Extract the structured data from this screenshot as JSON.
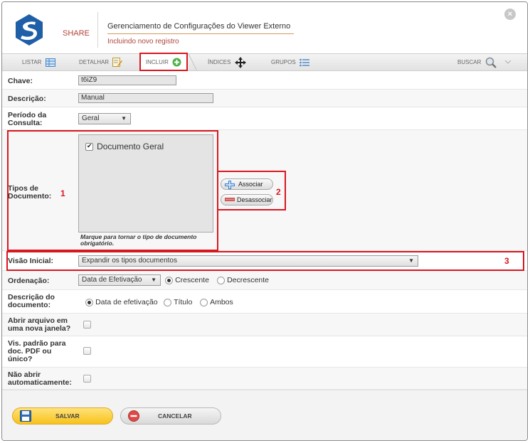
{
  "header": {
    "brand": "SHARE",
    "title": "Gerenciamento de Configurações do Viewer Externo",
    "subtitle": "Incluindo novo registro"
  },
  "tabs": {
    "listar": "LISTAR",
    "detalhar": "DETALHAR",
    "incluir": "INCLUIR",
    "indices": "ÍNDICES",
    "grupos": "GRUPOS",
    "buscar": "BUSCAR"
  },
  "form": {
    "chave": {
      "label": "Chave:",
      "value": "t6iZ9"
    },
    "descricao": {
      "label": "Descrição:",
      "value": "Manual"
    },
    "periodo": {
      "label": "Período da Consulta:",
      "value": "Geral"
    },
    "tipos": {
      "label": "Tipos de Documento:",
      "items": [
        {
          "label": "Documento Geral",
          "checked": true
        }
      ],
      "hint": "Marque para tornar o tipo de documento obrigatório.",
      "associar": "Associar",
      "desassociar": "Desassociar"
    },
    "visao": {
      "label": "Visão Inicial:",
      "value": "Expandir os tipos documentos"
    },
    "ordenacao": {
      "label": "Ordenação:",
      "value": "Data de Efetivação",
      "options": [
        "Crescente",
        "Decrescente"
      ],
      "selected": "Crescente"
    },
    "descricao_doc": {
      "label": "Descrição do documento:",
      "options": [
        "Data de efetivação",
        "Título",
        "Ambos"
      ],
      "selected": "Data de efetivação"
    },
    "abrir_janela": {
      "label": "Abrir arquivo em uma nova janela?",
      "checked": false
    },
    "vis_padrao": {
      "label": "Vis. padrão para doc. PDF ou único?",
      "checked": false
    },
    "nao_abrir": {
      "label": "Não abrir automaticamente:",
      "checked": false
    }
  },
  "annotations": {
    "one": "1",
    "two": "2",
    "three": "3"
  },
  "footer": {
    "save": "SALVAR",
    "cancel": "CANCELAR"
  },
  "colors": {
    "accent_red": "#d9171f",
    "brand_red": "#b0453d",
    "save_yellow": "#f7c21b",
    "logo_blue": "#1f5fa8"
  }
}
